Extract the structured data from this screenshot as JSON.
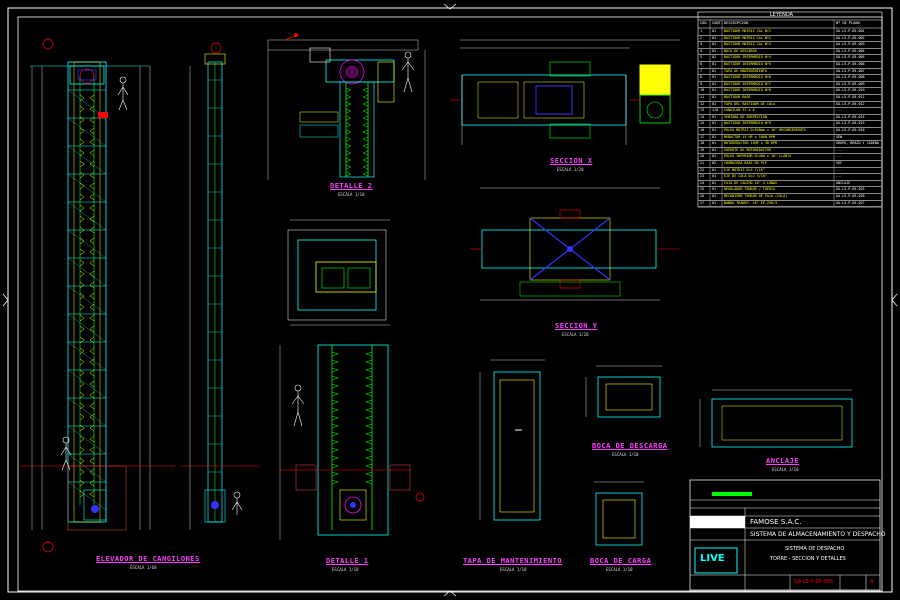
{
  "drawing_title": "",
  "views": {
    "elevator": {
      "title": "ELEVADOR DE CANGILONES",
      "scale": "ESCALA 1/60"
    },
    "detail_2": {
      "title": "DETALLE",
      "num": "2",
      "scale": "ESCALA 1/10"
    },
    "detail_1": {
      "title": "DETALLE",
      "num": "1",
      "scale": "ESCALA 1/10"
    },
    "section_x": {
      "title": "SECCION",
      "num": "X",
      "scale": "ESCALA 1/20"
    },
    "section_y": {
      "title": "SECCION",
      "num": "Y",
      "scale": "ESCALA 1/20"
    },
    "tapa": {
      "title": "TAPA DE MANTENIMIENTO",
      "scale": "ESCALA 1/10"
    },
    "boca_descarga": {
      "title": "BOCA DE DESCARGA",
      "scale": "ESCALA 1/10"
    },
    "boca_carga": {
      "title": "BOCA DE CARGA",
      "scale": "ESCALA 1/10"
    },
    "anclaje": {
      "title": "ANCLAJE",
      "scale": "ESCALA 1/10"
    }
  },
  "legend": {
    "title": "LEYENDA",
    "headers": [
      "COD.",
      "CANT.",
      "DESCRIPCION",
      "Nº DE PLANO"
    ],
    "rows": [
      [
        "1",
        "01",
        "BASTIDOR MOTRIZ CAL Nº1",
        "GA-L5-P-05-001"
      ],
      [
        "2",
        "01",
        "BASTIDOR MOTRIZ CAL Nº2",
        "GA-L5-P-05-002"
      ],
      [
        "3",
        "01",
        "BASTIDOR MOTRIZ CAL Nº3",
        "GA-L5-P-05-003"
      ],
      [
        "4",
        "01",
        "BOCA DE DESCARGA",
        "GA-L5-P-05-004"
      ],
      [
        "5",
        "02",
        "BASTIDOR INTERMEDIO Nº4",
        "GA-L5-P-05-005"
      ],
      [
        "6",
        "01",
        "BASTIDOR INTERMEDIO Nº5",
        "GA-L5-P-05-006"
      ],
      [
        "7",
        "01",
        "TAPA DE MANTENIMIENTO",
        "GA-L5-P-05-007"
      ],
      [
        "8",
        "01",
        "BASTIDOR INTERMEDIO Nº6",
        "GA-L5-P-05-008"
      ],
      [
        "9",
        "01",
        "BASTIDOR INTERMEDIO Nº7",
        "GA-L5-P-05-009"
      ],
      [
        "10",
        "01",
        "BASTIDOR INTERMEDIO Nº8",
        "GA-L5-P-05-010"
      ],
      [
        "11",
        "01",
        "BASTIDOR BASE",
        "GA-L5-P-05-011"
      ],
      [
        "12",
        "01",
        "TAPA DEL BASTIDOR DE COLA",
        "GA-L5-P-05-012"
      ],
      [
        "13",
        "110",
        "CANGILON 12 x 6",
        "---"
      ],
      [
        "14",
        "01",
        "VENTANA DE INSPECCION",
        "GA-L5-P-05-014"
      ],
      [
        "15",
        "01",
        "BASTIDOR INTERMEDIO Nº9",
        "GA-L5-P-05-015"
      ],
      [
        "16",
        "01",
        "POLEA MOTRIZ D=450mm x 16\" RECUBRIMIENTO",
        "GA-L5-P-05-016"
      ],
      [
        "17",
        "01",
        "REDUCTOR 15 HP x 1000 RPM",
        "SEW"
      ],
      [
        "18",
        "01",
        "MOTOREDUCTOR 15HP x 38 RPM",
        "GRUPO, BRAZO Y CADENA"
      ],
      [
        "19",
        "01",
        "SOPORTE DE MOTOREDUCTOR",
        "---"
      ],
      [
        "20",
        "01",
        "POLEA INFERIOR D=400 x 16\" LLANTA",
        "---"
      ],
      [
        "21",
        "02",
        "CHUMACERA BASE DE PIE",
        "SKF"
      ],
      [
        "22",
        "01",
        "EJE MOTRIZ D=3 7/16\"",
        "---"
      ],
      [
        "23",
        "01",
        "EJE DE COLA D=2 3/16\"",
        "---"
      ],
      [
        "24",
        "01",
        "FAJA DE CAUCHO 16\" 4 LONAS",
        "ANCLAJE"
      ],
      [
        "25",
        "01",
        "REGULADOR TENSOR / TUERCA",
        "GA-L5-P-05-025"
      ],
      [
        "26",
        "01",
        "MECANISMO TENSOR DE FAJA (COLA)",
        "GA-L5-P-05-026"
      ],
      [
        "27",
        "01",
        "BANDA TRANSP. 16\" EP-250/3",
        "GA-L5-P-05-027"
      ]
    ]
  },
  "title_block": {
    "company": "FAMOSE S.A.C.",
    "system": "SISTEMA DE ALMACENAMIENTO Y DESPACHO",
    "subtitle1": "SISTEMA DE DESPACHO",
    "subtitle2": "TORRE - SECCION Y DETALLES",
    "logo": "LIVE",
    "plan_no": "GA-L5-P-05-005",
    "rev": "A"
  },
  "colors": {
    "background": "#000000",
    "frame": "#ffffff",
    "structure": "#00ffff",
    "steel": "#ffff00",
    "belt": "#00ff00",
    "magenta": "#ff00ff",
    "red": "#ff2020",
    "blue": "#3060ff"
  }
}
